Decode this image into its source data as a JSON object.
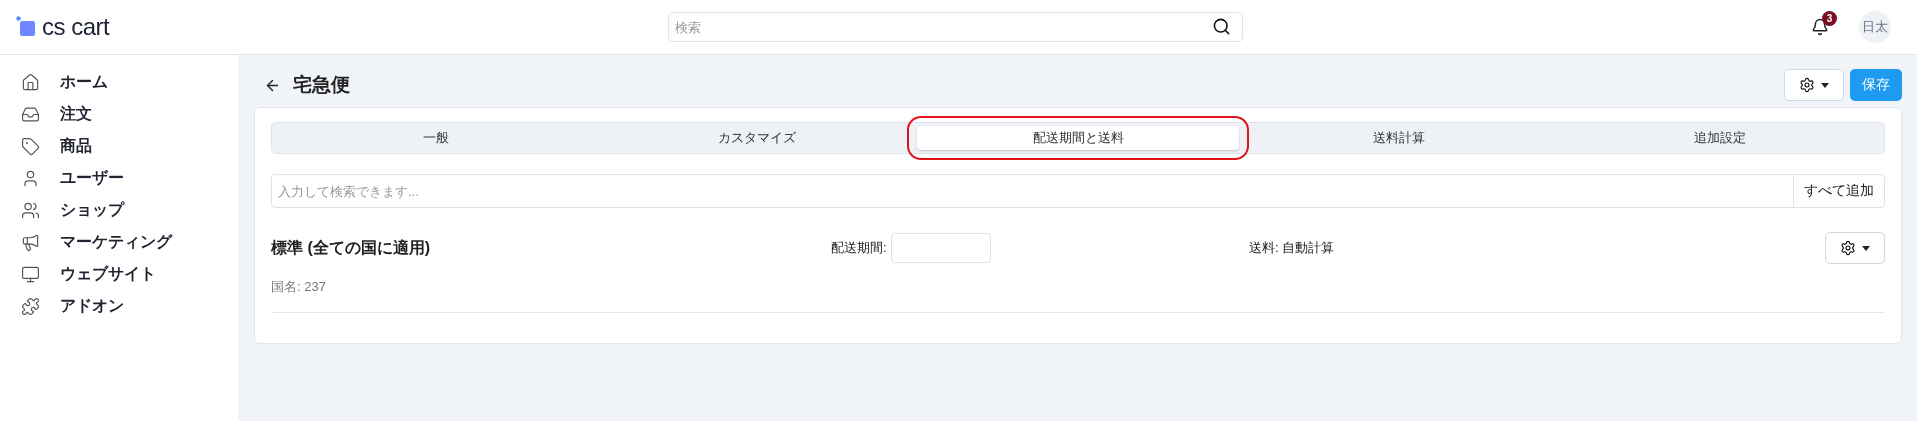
{
  "header": {
    "logo": "cs cart",
    "search": {
      "placeholder": "検索"
    },
    "notifications": {
      "count": "3"
    },
    "user": {
      "initials": "日太"
    }
  },
  "sidebar": {
    "items": [
      {
        "label": "ホーム"
      },
      {
        "label": "注文"
      },
      {
        "label": "商品"
      },
      {
        "label": "ユーザー"
      },
      {
        "label": "ショップ"
      },
      {
        "label": "マーケティング"
      },
      {
        "label": "ウェブサイト"
      },
      {
        "label": "アドオン"
      }
    ]
  },
  "page": {
    "title": "宅急便",
    "save_button": "保存"
  },
  "tabs": [
    {
      "label": "一般",
      "selected": false,
      "highlighted": false
    },
    {
      "label": "カスタマイズ",
      "selected": false,
      "highlighted": false
    },
    {
      "label": "配送期間と送料",
      "selected": true,
      "highlighted": true
    },
    {
      "label": "送料計算",
      "selected": false,
      "highlighted": false
    },
    {
      "label": "追加設定",
      "selected": false,
      "highlighted": false
    }
  ],
  "country_search": {
    "placeholder": "入力して検索できます...",
    "add_all_button": "すべて追加"
  },
  "rate": {
    "name": "標準 (全ての国に適用)",
    "delivery_label": "配送期間:",
    "fee": "送料: 自動計算",
    "countries": "国名: 237"
  }
}
